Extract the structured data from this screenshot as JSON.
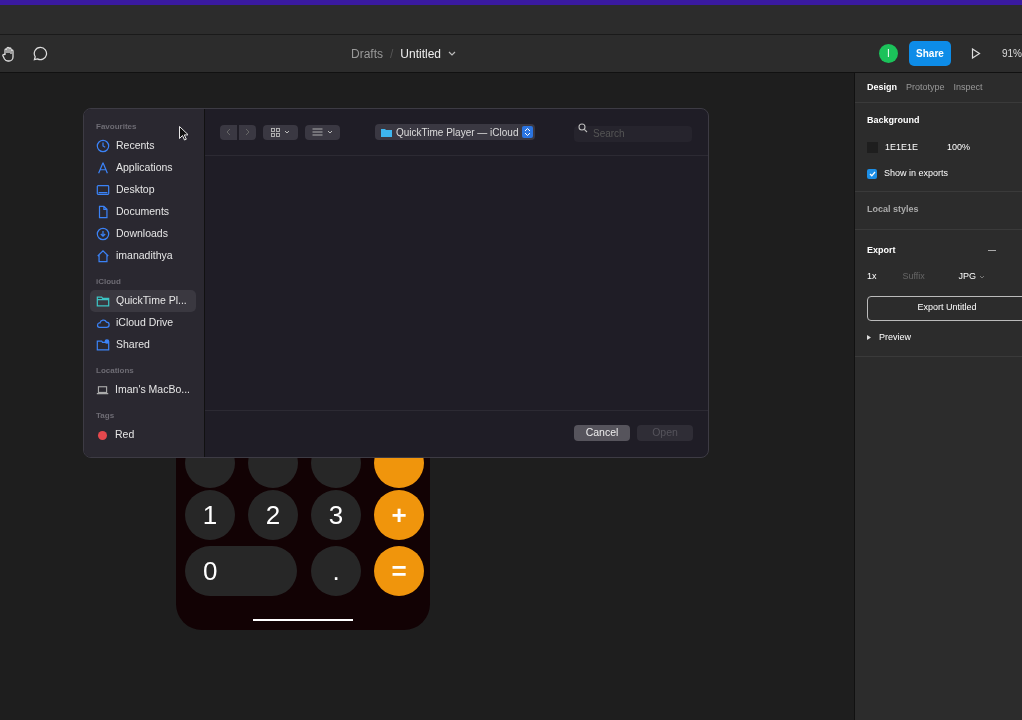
{
  "toolbar": {
    "breadcrumb_parent": "Drafts",
    "separator": "/",
    "file_name": "Untitled",
    "avatar_initial": "I",
    "share_label": "Share",
    "zoom": "91%"
  },
  "file_dialog": {
    "sidebar": [
      {
        "heading": "Favourites",
        "items": [
          {
            "label": "Recents",
            "selected": false
          },
          {
            "label": "Applications",
            "selected": false
          },
          {
            "label": "Desktop",
            "selected": false
          },
          {
            "label": "Documents",
            "selected": false
          },
          {
            "label": "Downloads",
            "selected": false
          },
          {
            "label": "imanadithya",
            "selected": false
          }
        ]
      },
      {
        "heading": "iCloud",
        "items": [
          {
            "label": "QuickTime Pl...",
            "selected": true
          },
          {
            "label": "iCloud Drive",
            "selected": false
          },
          {
            "label": "Shared",
            "selected": false
          }
        ]
      },
      {
        "heading": "Locations",
        "items": [
          {
            "label": "Iman's MacBo...",
            "selected": false
          }
        ]
      },
      {
        "heading": "Tags",
        "items": [
          {
            "label": "Red",
            "color": "#e5484d",
            "selected": false
          }
        ]
      }
    ],
    "location": "QuickTime Player — iCloud",
    "search_placeholder": "Search",
    "cancel": "Cancel",
    "open": {
      "label": "Open",
      "disabled": true
    }
  },
  "calculator": {
    "keys": [
      {
        "label": "1",
        "kind": "digit"
      },
      {
        "label": "2",
        "kind": "digit"
      },
      {
        "label": "3",
        "kind": "digit"
      },
      {
        "label": "+",
        "kind": "operator"
      },
      {
        "label": "0",
        "kind": "wide"
      },
      {
        "label": ".",
        "kind": "digit"
      },
      {
        "label": "=",
        "kind": "operator"
      }
    ]
  },
  "panel": {
    "tabs": [
      {
        "label": "Design",
        "selected": true
      },
      {
        "label": "Prototype",
        "selected": false
      },
      {
        "label": "Inspect",
        "selected": false
      }
    ],
    "background": {
      "title": "Background",
      "hex": "1E1E1E",
      "opacity": "100%",
      "show_in_exports": {
        "label": "Show in exports",
        "checked": true
      }
    },
    "local_styles": "Local styles",
    "export": {
      "title": "Export",
      "scale": "1x",
      "suffix_placeholder": "Suffix",
      "format": "JPG",
      "button": "Export Untitled",
      "preview": "Preview"
    }
  }
}
